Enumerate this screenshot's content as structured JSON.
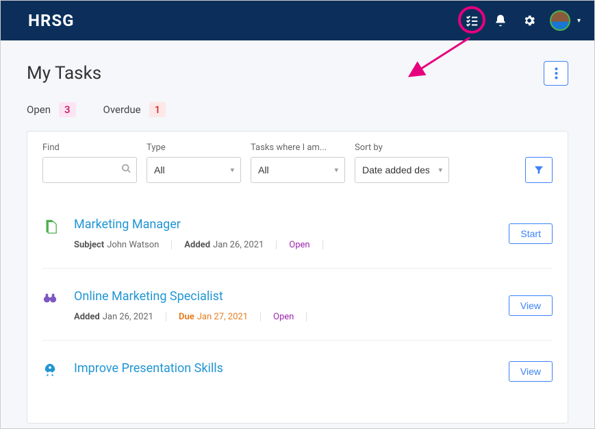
{
  "header": {
    "logo": "HRSG"
  },
  "page": {
    "title": "My Tasks"
  },
  "counts": {
    "open_label": "Open",
    "open_value": "3",
    "overdue_label": "Overdue",
    "overdue_value": "1"
  },
  "filters": {
    "find_label": "Find",
    "type_label": "Type",
    "type_value": "All",
    "role_label": "Tasks where I am...",
    "role_value": "All",
    "sort_label": "Sort by",
    "sort_value": "Date added des"
  },
  "tasks": [
    {
      "title": "Marketing Manager",
      "subject_label": "Subject",
      "subject": "John Watson",
      "added_label": "Added",
      "added": "Jan 26, 2021",
      "status": "Open",
      "action": "Start",
      "icon_color": "#4caf50"
    },
    {
      "title": "Online Marketing Specialist",
      "added_label": "Added",
      "added": "Jan 26, 2021",
      "due_label": "Due",
      "due": "Jan 27, 2021",
      "status": "Open",
      "action": "View"
    },
    {
      "title": "Improve Presentation Skills",
      "action": "View"
    }
  ]
}
